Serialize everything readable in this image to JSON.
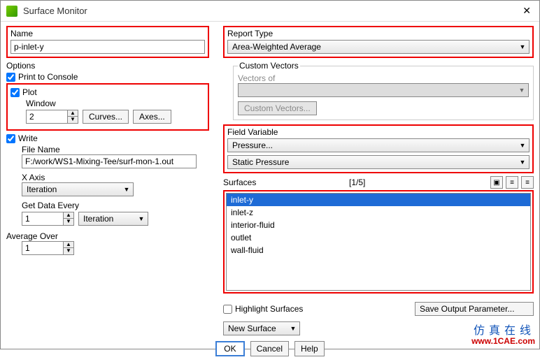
{
  "title": "Surface Monitor",
  "left": {
    "name_label": "Name",
    "name_value": "p-inlet-y",
    "options_label": "Options",
    "print_to_console": "Print to Console",
    "plot": "Plot",
    "window_label": "Window",
    "window_value": "2",
    "curves_btn": "Curves...",
    "axes_btn": "Axes...",
    "write": "Write",
    "file_name_label": "File Name",
    "file_name_value": "F:/work/WS1-Mixing-Tee/surf-mon-1.out",
    "x_axis_label": "X Axis",
    "x_axis_value": "Iteration",
    "get_data_label": "Get Data Every",
    "get_data_value": "1",
    "get_data_unit": "Iteration",
    "avg_over_label": "Average Over",
    "avg_over_value": "1"
  },
  "right": {
    "report_type_label": "Report Type",
    "report_type_value": "Area-Weighted Average",
    "custom_vectors_label": "Custom Vectors",
    "vectors_of_label": "Vectors of",
    "custom_vectors_btn": "Custom Vectors...",
    "field_var_label": "Field Variable",
    "field_var_value1": "Pressure...",
    "field_var_value2": "Static Pressure",
    "surfaces_label": "Surfaces",
    "surfaces_count": "[1/5]",
    "surfaces": [
      "inlet-y",
      "inlet-z",
      "interior-fluid",
      "outlet",
      "wall-fluid"
    ],
    "selected_surface": 0,
    "highlight_label": "Highlight Surfaces",
    "save_output_btn": "Save Output Parameter...",
    "new_surface_btn": "New Surface"
  },
  "buttons": {
    "ok": "OK",
    "cancel": "Cancel",
    "help": "Help"
  },
  "watermark": {
    "cn": "仿真在线",
    "url": "www.1CAE.com"
  }
}
